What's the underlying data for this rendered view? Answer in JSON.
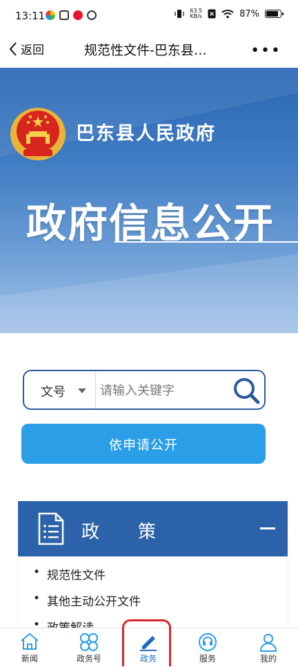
{
  "status_bar": {
    "time": "13:11",
    "net_speed_value": "63.5",
    "net_speed_unit": "KB/s",
    "battery": "87%",
    "battery_level": 0.87
  },
  "nav": {
    "back_label": "返回",
    "title": "规范性文件-巴东县…",
    "more_label": "•••"
  },
  "banner": {
    "gov_name": "巴东县人民政府",
    "title": "政府信息公开"
  },
  "search": {
    "select_value": "文号",
    "placeholder": "请输入关键字"
  },
  "apply_button": "依申请公开",
  "policy": {
    "title": "政策",
    "items": [
      "规范性文件",
      "其他主动公开文件",
      "政策解读"
    ]
  },
  "tabs": [
    {
      "label": "新闻",
      "icon": "home-icon"
    },
    {
      "label": "政务号",
      "icon": "clover-icon"
    },
    {
      "label": "政务",
      "icon": "pen-icon"
    },
    {
      "label": "服务",
      "icon": "service-icon"
    },
    {
      "label": "我的",
      "icon": "user-icon"
    }
  ],
  "colors": {
    "primary": "#2c62a9",
    "button": "#2a9ee6",
    "active_tab": "#1e6ec0",
    "highlight": "#d9262b"
  }
}
